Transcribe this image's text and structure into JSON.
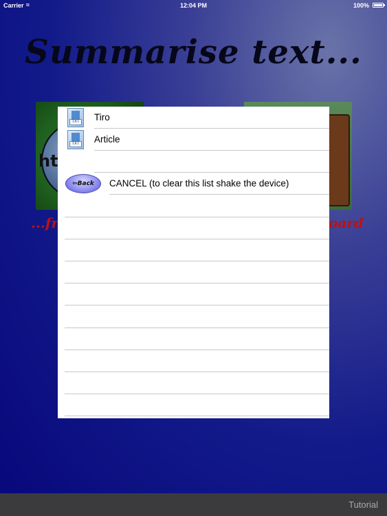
{
  "status_bar": {
    "carrier": "Carrier",
    "wifi_icon": "wifi-icon",
    "time": "12:04 PM",
    "battery": "100%"
  },
  "app": {
    "title": "Summarise text...",
    "left_caption": "...fro",
    "right_caption": "oard"
  },
  "popover": {
    "items": [
      {
        "label": "Tiro",
        "icon": "txt-file-icon",
        "icon_text": "TXT"
      },
      {
        "label": "Article",
        "icon": "txt-file-icon",
        "icon_text": "TXT"
      }
    ],
    "back_button": "Back",
    "cancel_label": "CANCEL (to clear this list shake the device)"
  },
  "bottom_bar": {
    "tutorial_label": "Tutorial"
  },
  "colors": {
    "background_top": "#6a73a8",
    "background_bottom": "#07077a",
    "caption": "#c01010",
    "separator": "#c8c7cc",
    "bottom_bar": "#3b3b3e"
  }
}
